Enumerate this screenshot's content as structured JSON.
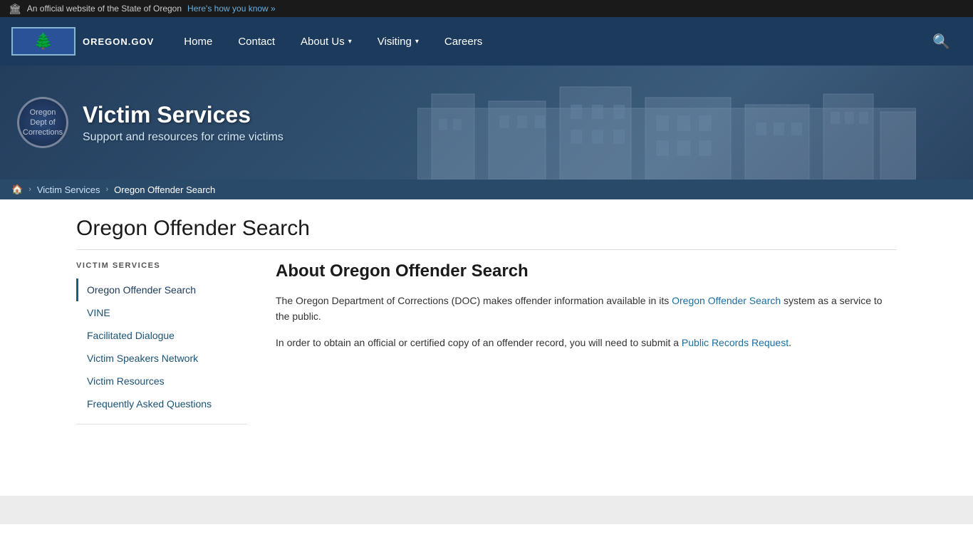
{
  "topbar": {
    "gov_text": "An official website of the State of Oregon",
    "know_link": "Here's how you know »",
    "flag_emoji": "🏛"
  },
  "nav": {
    "logo_text": "OREGON.GOV",
    "tree_emoji": "🌲",
    "links": [
      {
        "label": "Home",
        "has_arrow": false
      },
      {
        "label": "Contact",
        "has_arrow": false
      },
      {
        "label": "About Us",
        "has_arrow": true
      },
      {
        "label": "Visiting",
        "has_arrow": true
      },
      {
        "label": "Careers",
        "has_arrow": false
      }
    ],
    "search_aria": "Search"
  },
  "hero": {
    "title": "Victim Services",
    "subtitle": "Support and resources for crime victims",
    "seal_line1": "Oregon",
    "seal_line2": "Dept of",
    "seal_line3": "Corrections"
  },
  "breadcrumb": {
    "home_icon": "🏠",
    "victim_services": "Victim Services",
    "current": "Oregon Offender Search"
  },
  "page": {
    "title": "Oregon Offender Search"
  },
  "sidebar": {
    "section_label": "Victim Services",
    "items": [
      {
        "label": "Oregon Offender Search",
        "active": true
      },
      {
        "label": "VINE",
        "active": false
      },
      {
        "label": "Facilitated Dialogue",
        "active": false
      },
      {
        "label": "Victim Speakers Network",
        "active": false
      },
      {
        "label": "Victim Resources",
        "active": false
      },
      {
        "label": "Frequently Asked Questions",
        "active": false
      }
    ]
  },
  "article": {
    "title": "About Oregon Offender Search",
    "para1_before": "The Oregon Department of Corrections (DOC) makes offender information available in its ",
    "para1_link": "Oregon Offender Search",
    "para1_after": " system as a service to the public.",
    "para2_before": "In order to obtain an official or certified copy of an offender record, you will need to submit a ",
    "para2_link": "Public Records Request",
    "para2_after": "."
  },
  "colors": {
    "nav_bg": "#1b3a5c",
    "accent_blue": "#1a6ea0",
    "sidebar_active_border": "#1b5e82"
  }
}
